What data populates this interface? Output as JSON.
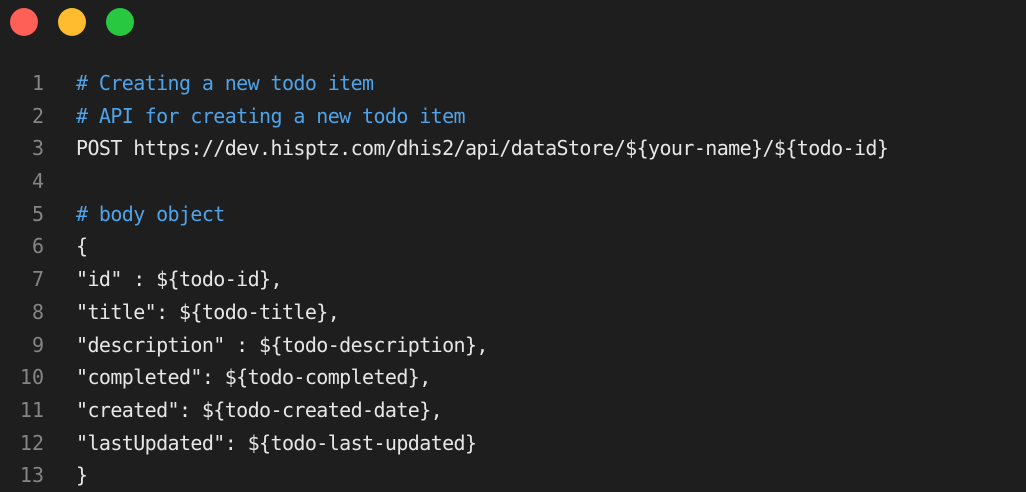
{
  "colors": {
    "background": "#1e1e1e",
    "close": "#fe5f57",
    "minimize": "#febc2e",
    "maximize": "#28c840",
    "comment": "#4fa3e8",
    "text": "#e6e6e6",
    "line_number": "#858585"
  },
  "window_controls": [
    {
      "name": "close-dot",
      "color": "#fe5f57"
    },
    {
      "name": "minimize-dot",
      "color": "#febc2e"
    },
    {
      "name": "maximize-dot",
      "color": "#28c840"
    }
  ],
  "code": {
    "lines": [
      {
        "number": "1",
        "text": "# Creating a new todo item",
        "kind": "comment"
      },
      {
        "number": "2",
        "text": "# API for creating a new todo item",
        "kind": "comment"
      },
      {
        "number": "3",
        "text": "POST https://dev.hisptz.com/dhis2/api/dataStore/${your-name}/${todo-id}",
        "kind": "plain"
      },
      {
        "number": "4",
        "text": "",
        "kind": "plain"
      },
      {
        "number": "5",
        "text": "# body object",
        "kind": "comment"
      },
      {
        "number": "6",
        "text": "{",
        "kind": "plain"
      },
      {
        "number": "7",
        "text": "\"id\" : ${todo-id},",
        "kind": "plain"
      },
      {
        "number": "8",
        "text": "\"title\": ${todo-title},",
        "kind": "plain"
      },
      {
        "number": "9",
        "text": "\"description\" : ${todo-description},",
        "kind": "plain"
      },
      {
        "number": "10",
        "text": "\"completed\": ${todo-completed},",
        "kind": "plain"
      },
      {
        "number": "11",
        "text": "\"created\": ${todo-created-date},",
        "kind": "plain"
      },
      {
        "number": "12",
        "text": "\"lastUpdated\": ${todo-last-updated}",
        "kind": "plain"
      },
      {
        "number": "13",
        "text": "}",
        "kind": "plain"
      }
    ]
  }
}
